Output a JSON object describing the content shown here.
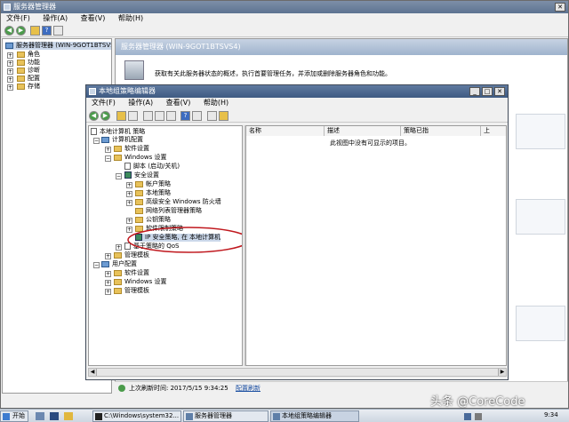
{
  "server_manager": {
    "title": "服务器管理器",
    "menu": [
      "文件(F)",
      "操作(A)",
      "查看(V)",
      "帮助(H)"
    ],
    "tree_root": "服务器管理器 (WIN-9GOT1BTSVS",
    "tree_items": [
      "角色",
      "功能",
      "诊断",
      "配置",
      "存储"
    ],
    "panel_title": "服务器管理器 (WIN-9GOT1BTSVS4)",
    "description": "获取有关此服务器状态的概述，执行首要管理任务，并添加或删除服务器角色和功能。",
    "status_label": "上次刷新时间: 2017/5/15 9:34:25",
    "refresh_link": "配置刷新"
  },
  "gpo_editor": {
    "title": "本地组策略编辑器",
    "menu": [
      "文件(F)",
      "操作(A)",
      "查看(V)",
      "帮助(H)"
    ],
    "tree": {
      "root": "本地计算机 策略",
      "computer_config": "计算机配置",
      "software_settings": "软件设置",
      "windows_settings": "Windows 设置",
      "scripts": "脚本 (启动/关机)",
      "security_settings": "安全设置",
      "account_policies": "帐户策略",
      "local_policies": "本地策略",
      "firewall": "高级安全 Windows 防火墙",
      "network_list": "网络列表管理器策略",
      "public_key": "公钥策略",
      "software_restriction": "软件限制策略",
      "ip_security": "IP 安全策略, 在 本地计算机",
      "qos": "基于策略的 QoS",
      "admin_templates": "管理模板",
      "user_config": "用户配置",
      "user_software": "软件设置",
      "user_windows": "Windows 设置",
      "user_admin": "管理模板"
    },
    "columns": [
      "名称",
      "描述",
      "策略已指  ",
      "上"
    ],
    "empty_message": "此视图中没有可显示的项目。"
  },
  "taskbar": {
    "start": "开始",
    "items": [
      "C:\\Windows\\system32...",
      "服务器管理器",
      "本地组策略编辑器"
    ],
    "clock": "9:34"
  },
  "watermark": "头条 @CoreCode",
  "colors": {
    "annotation": "#c0181e",
    "accent": "#3a6ea5"
  }
}
